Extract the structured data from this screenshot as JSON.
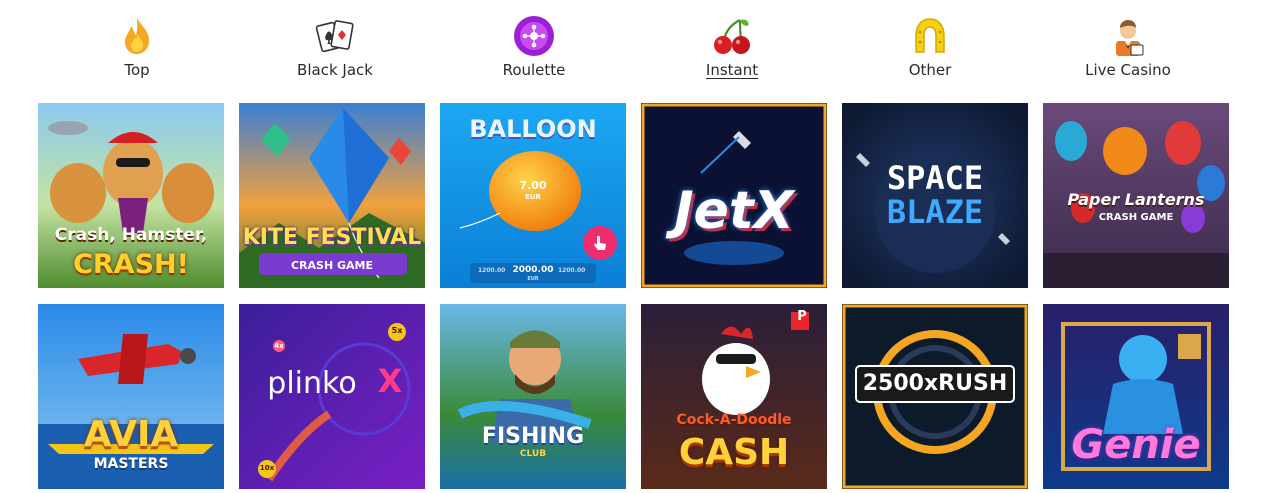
{
  "categories": [
    {
      "label": "Top",
      "icon": "fire-icon"
    },
    {
      "label": "Black Jack",
      "icon": "playing-cards-icon"
    },
    {
      "label": "Roulette",
      "icon": "roulette-icon"
    },
    {
      "label": "Instant",
      "icon": "cherries-icon",
      "active": true
    },
    {
      "label": "Other",
      "icon": "horseshoe-icon"
    },
    {
      "label": "Live Casino",
      "icon": "dealer-icon"
    }
  ],
  "games": {
    "crash_hamster": {
      "line1": "Crash, Hamster,",
      "line2": "CRASH!"
    },
    "kite_festival": {
      "title": "KITE FESTIVAL",
      "subtitle": "CRASH GAME"
    },
    "balloon": {
      "title": "BALLOON",
      "value": "7.00",
      "currency": "EUR",
      "left_amount": "1200.00",
      "bet": "2000.00",
      "bet_currency": "EUR",
      "right_amount": "1200.00"
    },
    "jetx": {
      "title": "JetX"
    },
    "space_blaze": {
      "line1": "SPACE",
      "line2": "BLAZE"
    },
    "paper_lanterns": {
      "title": "Paper Lanterns",
      "subtitle": "CRASH GAME"
    },
    "avia_masters": {
      "line1": "AVIA",
      "line2": "MASTERS"
    },
    "plinko_x": {
      "title": "plinko",
      "x": "X",
      "badge_top": "5x",
      "badge_left": "4x",
      "badge_bottom": "10x"
    },
    "fishing_club": {
      "title": "FISHING",
      "subtitle": "CLUB"
    },
    "cock_a_doodle": {
      "line1": "Cock-A-Doodle",
      "line2": "CASH",
      "badge": "P"
    },
    "rush_2500": {
      "title": "2500xRUSH"
    },
    "genie": {
      "title": "Genie"
    }
  }
}
